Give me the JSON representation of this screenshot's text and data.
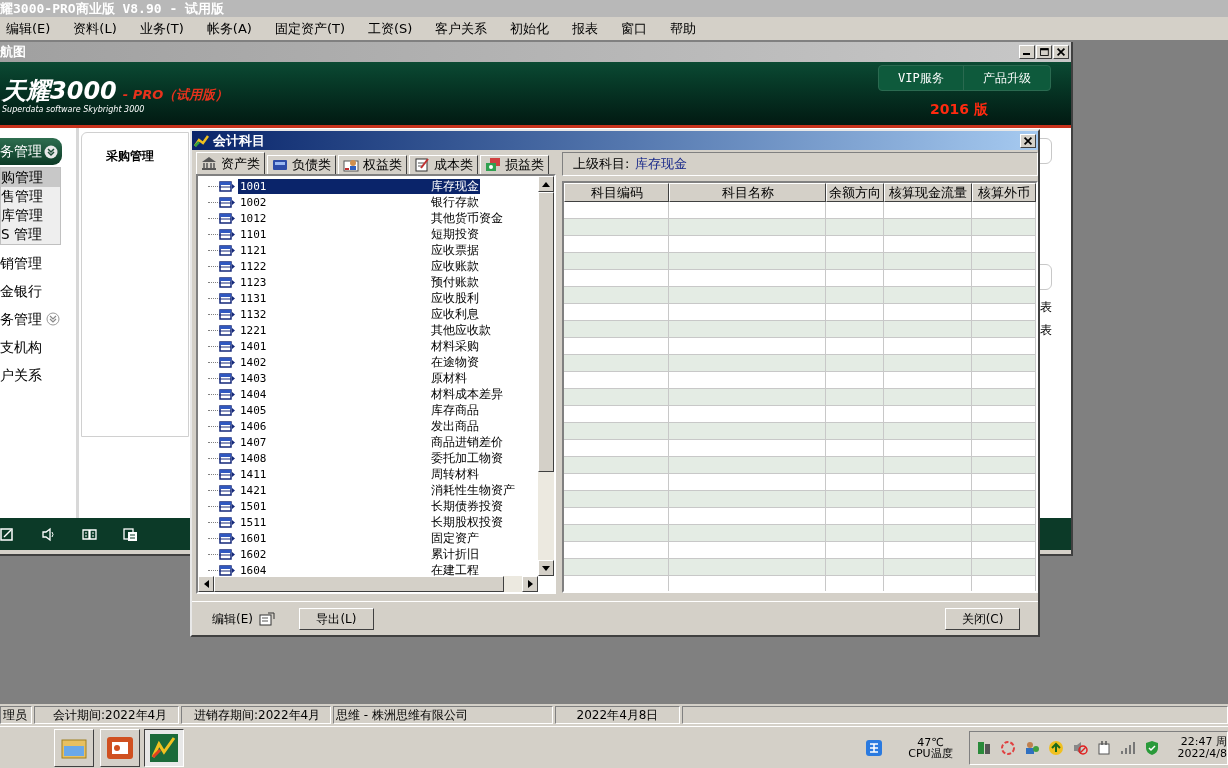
{
  "app_title": "耀3000-PRO商业版 V8.90 - 试用版",
  "menu": [
    "编辑(E)",
    "资料(L)",
    "业务(T)",
    "帐务(A)",
    "固定资产(T)",
    "工资(S)",
    "客户关系",
    "初始化",
    "报表",
    "窗口",
    "帮助"
  ],
  "child_window": {
    "title": "航图",
    "banner": {
      "logo": "天耀3000",
      "edition": "- PRO（试用版）",
      "tagline": "Superdata software Skybright 3000",
      "buttons": [
        "VIP服务",
        "产品升级"
      ],
      "version": "2016 版"
    },
    "nav": [
      {
        "kind": "group",
        "label": "务管理",
        "expanded": true,
        "children": [
          {
            "label": "购管理",
            "selected": true
          },
          {
            "label": "售管理",
            "selected": false
          },
          {
            "label": "库管理",
            "selected": false
          },
          {
            "label": "S 管理",
            "selected": false
          }
        ]
      },
      {
        "kind": "link",
        "label": "销管理"
      },
      {
        "kind": "link",
        "label": "金银行"
      },
      {
        "kind": "group",
        "label": "务管理",
        "expanded": false
      },
      {
        "kind": "link",
        "label": "支机构"
      },
      {
        "kind": "link",
        "label": "户关系"
      }
    ],
    "tab": "采购管理",
    "right_fragments": [
      "表",
      "表"
    ]
  },
  "dialog": {
    "title": "会计科目",
    "tabs": [
      {
        "label": "资产类",
        "selected": true
      },
      {
        "label": "负债类",
        "selected": false
      },
      {
        "label": "权益类",
        "selected": false
      },
      {
        "label": "成本类",
        "selected": false
      },
      {
        "label": "损益类",
        "selected": false
      }
    ],
    "accounts": [
      {
        "code": "1001",
        "name": "库存现金",
        "selected": true
      },
      {
        "code": "1002",
        "name": "银行存款",
        "selected": false
      },
      {
        "code": "1012",
        "name": "其他货币资金",
        "selected": false
      },
      {
        "code": "1101",
        "name": "短期投资",
        "selected": false
      },
      {
        "code": "1121",
        "name": "应收票据",
        "selected": false
      },
      {
        "code": "1122",
        "name": "应收账款",
        "selected": false
      },
      {
        "code": "1123",
        "name": "预付账款",
        "selected": false
      },
      {
        "code": "1131",
        "name": "应收股利",
        "selected": false
      },
      {
        "code": "1132",
        "name": "应收利息",
        "selected": false
      },
      {
        "code": "1221",
        "name": "其他应收款",
        "selected": false
      },
      {
        "code": "1401",
        "name": "材料采购",
        "selected": false
      },
      {
        "code": "1402",
        "name": "在途物资",
        "selected": false
      },
      {
        "code": "1403",
        "name": "原材料",
        "selected": false
      },
      {
        "code": "1404",
        "name": "材料成本差异",
        "selected": false
      },
      {
        "code": "1405",
        "name": "库存商品",
        "selected": false
      },
      {
        "code": "1406",
        "name": "发出商品",
        "selected": false
      },
      {
        "code": "1407",
        "name": "商品进销差价",
        "selected": false
      },
      {
        "code": "1408",
        "name": "委托加工物资",
        "selected": false
      },
      {
        "code": "1411",
        "name": "周转材料",
        "selected": false
      },
      {
        "code": "1421",
        "name": "消耗性生物资产",
        "selected": false
      },
      {
        "code": "1501",
        "name": "长期债券投资",
        "selected": false
      },
      {
        "code": "1511",
        "name": "长期股权投资",
        "selected": false
      },
      {
        "code": "1601",
        "name": "固定资产",
        "selected": false
      },
      {
        "code": "1602",
        "name": "累计折旧",
        "selected": false
      },
      {
        "code": "1604",
        "name": "在建工程",
        "selected": false
      }
    ],
    "parent_label": "上级科目:",
    "parent_value": "库存现金",
    "columns": [
      "科目编码",
      "科目名称",
      "余额方向",
      "核算现金流量",
      "核算外币"
    ],
    "edit_label": "编辑(E)",
    "buttons": [
      "导出(L)",
      "关闭(C)"
    ]
  },
  "status_bar": [
    "理员",
    "会计期间:2022年4月",
    "进销存期间:2022年4月",
    "思维 - 株洲思维有限公司",
    "2022年4月8日"
  ],
  "taskbar": {
    "temperature": "47℃",
    "temperature_label": "CPU温度",
    "time": "22:47 周",
    "date": "2022/4/8"
  }
}
